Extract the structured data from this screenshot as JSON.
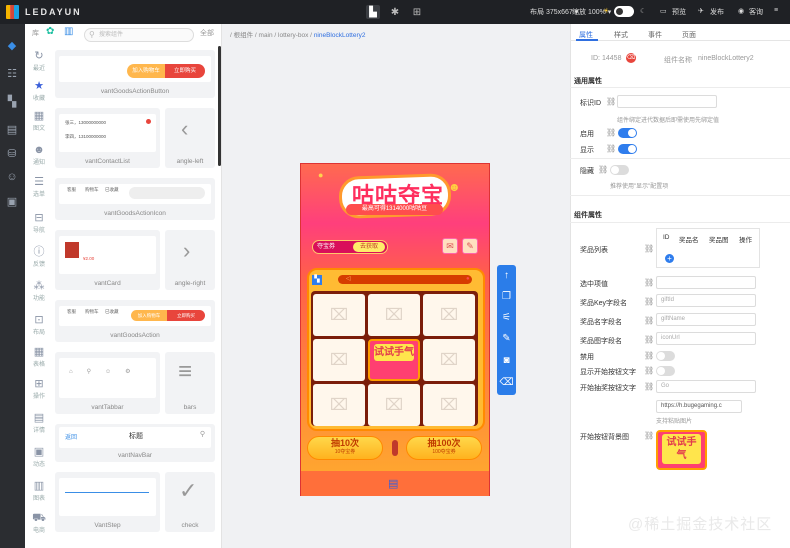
{
  "app": {
    "logo_text": "LEDAYUN"
  },
  "topbar": {
    "layout_label": "布局 375x667 ▾",
    "zoom_label": "缩放 100% ▾",
    "preview_label": "预览",
    "publish_label": "发布",
    "inbox_label": "客询"
  },
  "component_panel": {
    "tab_lib": "库",
    "search_placeholder": "搜索组件",
    "all_label": "全部",
    "categories": [
      "最近",
      "收藏",
      "图文",
      "通知",
      "选单",
      "导航",
      "反馈",
      "功能",
      "布局",
      "表格",
      "操作",
      "详情",
      "动态",
      "图表",
      "电商"
    ],
    "components": [
      {
        "name": "vantGoodsActionButton"
      },
      {
        "name": "vantContactList"
      },
      {
        "name": "angle-left"
      },
      {
        "name": "vantGoodsActionIcon"
      },
      {
        "name": "vantCard"
      },
      {
        "name": "angle-right"
      },
      {
        "name": "vantGoodsAction"
      },
      {
        "name": "vantTabbar"
      },
      {
        "name": "bars"
      },
      {
        "name": "vantNavBar"
      },
      {
        "name": "VantStep"
      },
      {
        "name": "check"
      }
    ],
    "preview_texts": {
      "add_cart": "加入购物车",
      "buy_now": "立即购买",
      "service": "客服",
      "cart": "购物车",
      "shop": "已收藏",
      "back": "返回",
      "nav_title": "标题",
      "contact1": "张三，13000000000",
      "contact2": "李四，13100000000",
      "price": "¥2.00"
    }
  },
  "canvas": {
    "breadcrumb_prefix": "/ 根组件 / main / lottery-box /",
    "breadcrumb_current": "nineBlockLottery2"
  },
  "phone": {
    "banner_title": "咕咕夺宝",
    "banner_sub": "最高可得1314000咕咕豆",
    "rule_left": "夺宝券",
    "rule_btn": "去获取",
    "center_text": "试试手气",
    "btn1_big": "抽10次",
    "btn1_small": "10夺宝券",
    "btn2_big": "抽100次",
    "btn2_small": "100夺宝券"
  },
  "right_panel": {
    "tabs": [
      "属性",
      "样式",
      "事件",
      "页面"
    ],
    "id_label": "ID:",
    "id_value": "14458",
    "comp_name_label": "组件名称",
    "comp_name_value": "nineBlockLottery2",
    "general_title": "通用属性",
    "identifier_label": "标识ID",
    "identifier_hint": "组件绑定进代数据后即需使用先绑定值",
    "enable_label": "启用",
    "show_label": "显示",
    "hide_label": "隐藏",
    "hide_hint": "推荐使用\"显示\"配置项",
    "component_title": "组件属性",
    "prize_list_label": "奖品列表",
    "table_headers": [
      "ID",
      "奖品名",
      "奖品图",
      "操作"
    ],
    "selected_label": "选中项值",
    "key_label": "奖品Key字段名",
    "key_value": "giftId",
    "name_label": "奖品名字段名",
    "name_value": "giftName",
    "img_label": "奖品图字段名",
    "img_value": "iconUrl",
    "disabled_label": "禁用",
    "show_start_text_label": "显示开始按钮文字",
    "start_text_label": "开始抽奖按钮文字",
    "start_text_value": "Go",
    "url_value": "https://h.bugegaming.c",
    "paste_hint": "支持粘贴图片",
    "bg_label": "开始按钮背景图",
    "thumb_text": "试试手气"
  },
  "watermark": "@稀土掘金技术社区"
}
